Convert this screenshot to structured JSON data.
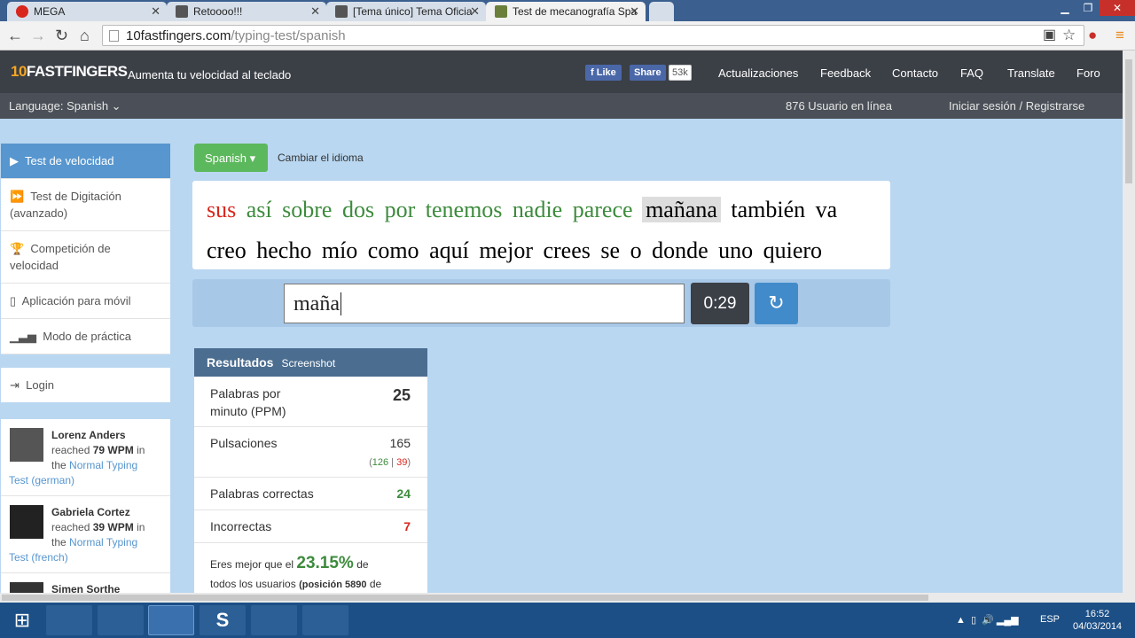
{
  "browser": {
    "tabs": [
      {
        "label": "MEGA",
        "icon": "mega-icon"
      },
      {
        "label": "Retoooo!!!",
        "icon": "forum-icon"
      },
      {
        "label": "[Tema único] Tema Oficia",
        "icon": "forum-icon"
      },
      {
        "label": "Test de mecanografía Spa",
        "icon": "tenfastfingers-icon"
      }
    ],
    "url_domain": "10fastfingers.com",
    "url_path": "/typing-test/spanish"
  },
  "header": {
    "logo_prefix": "10",
    "logo_text": "FASTFINGERS",
    "tagline": "Aumenta tu velocidad al teclado",
    "fb_like": "Like",
    "fb_share": "Share",
    "fb_count": "53k",
    "nav": [
      "Actualizaciones",
      "Feedback",
      "Contacto",
      "FAQ",
      "Translate",
      "Foro"
    ]
  },
  "subheader": {
    "language": "Language: Spanish",
    "online": "876 Usuario en línea",
    "login": "Iniciar sesión / Registrarse"
  },
  "sidebar": {
    "items": [
      {
        "label": "Test de velocidad",
        "icon": "play-icon"
      },
      {
        "label": "Test de Digitación (avanzado)",
        "icon": "fast-forward-icon"
      },
      {
        "label": "Competición de velocidad",
        "icon": "trophy-icon"
      },
      {
        "label": "Aplicación para móvil",
        "icon": "mobile-icon"
      },
      {
        "label": "Modo de práctica",
        "icon": "signal-icon"
      }
    ],
    "login": "Login",
    "feed": [
      {
        "name": "Lorenz Anders",
        "reached": "reached",
        "wpm": "79 WPM",
        "in": "in",
        "the": "the",
        "test": "Normal Typing",
        "lang": "Test (german)"
      },
      {
        "name": "Gabriela Cortez",
        "reached": "reached",
        "wpm": "39 WPM",
        "in": "in",
        "the": "the",
        "test": "Normal Typing",
        "lang": "Test (french)"
      },
      {
        "name": "Simen Sorthe"
      }
    ]
  },
  "test": {
    "language_button": "Spanish",
    "change_language": "Cambiar el idioma",
    "line1": [
      {
        "w": "sus",
        "s": "bad"
      },
      {
        "w": "así",
        "s": "ok"
      },
      {
        "w": "sobre",
        "s": "ok"
      },
      {
        "w": "dos",
        "s": "ok"
      },
      {
        "w": "por",
        "s": "ok"
      },
      {
        "w": "tenemos",
        "s": "ok"
      },
      {
        "w": "nadie",
        "s": "ok"
      },
      {
        "w": "parece",
        "s": "ok"
      },
      {
        "w": "mañana",
        "s": "cur"
      },
      {
        "w": "también",
        "s": ""
      },
      {
        "w": "va",
        "s": ""
      }
    ],
    "line2": [
      "creo",
      "hecho",
      "mío",
      "como",
      "aquí",
      "mejor",
      "crees",
      "se",
      "o",
      "donde",
      "uno",
      "quiero"
    ],
    "input_value": "maña",
    "timer": "0:29"
  },
  "results": {
    "title": "Resultados",
    "screenshot": "Screenshot",
    "wpm_label": "Palabras por minuto (PPM)",
    "wpm_value": "25",
    "keystrokes_label": "Pulsaciones",
    "keystrokes_value": "165",
    "keystrokes_correct": "126",
    "keystrokes_wrong": "39",
    "correct_label": "Palabras correctas",
    "correct_value": "24",
    "wrong_label": "Incorrectas",
    "wrong_value": "7",
    "better_prefix": "Eres mejor que el",
    "better_percent": "23.15%",
    "better_suffix": "de",
    "better_line2": "todos los usuarios",
    "better_position": "(posición 5890",
    "better_position_suffix": "de"
  },
  "taskbar": {
    "language": "ESP",
    "time": "16:52",
    "date": "04/03/2014"
  },
  "colors": {
    "correct": "#3d8b3d",
    "wrong": "#d9261c",
    "accent": "#5796cf"
  }
}
